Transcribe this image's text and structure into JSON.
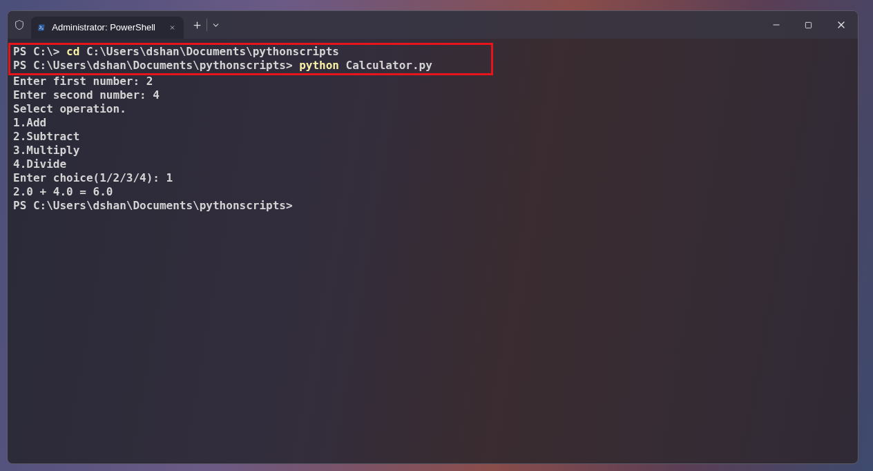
{
  "window": {
    "tab": {
      "title": "Administrator: PowerShell",
      "selected": true
    }
  },
  "terminal": {
    "blocks": [
      {
        "kind": "highlighted",
        "lines": [
          [
            {
              "kind": "prompt",
              "text": "PS C:\\>"
            },
            {
              "kind": "command",
              "text": "cd"
            },
            {
              "kind": "arg",
              "text": "C:\\Users\\dshan\\Documents\\pythonscripts"
            }
          ],
          [
            {
              "kind": "prompt",
              "text": "PS C:\\Users\\dshan\\Documents\\pythonscripts>"
            },
            {
              "kind": "command",
              "text": "python"
            },
            {
              "kind": "arg",
              "text": "Calculator.py"
            }
          ]
        ]
      },
      {
        "kind": "plain",
        "lines": [
          [
            {
              "kind": "output",
              "text": "Enter first number: 2"
            }
          ],
          [
            {
              "kind": "output",
              "text": "Enter second number: 4"
            }
          ],
          [
            {
              "kind": "output",
              "text": "Select operation."
            }
          ],
          [
            {
              "kind": "output",
              "text": "1.Add"
            }
          ],
          [
            {
              "kind": "output",
              "text": "2.Subtract"
            }
          ],
          [
            {
              "kind": "output",
              "text": "3.Multiply"
            }
          ],
          [
            {
              "kind": "output",
              "text": "4.Divide"
            }
          ],
          [
            {
              "kind": "output",
              "text": "Enter choice(1/2/3/4): 1"
            }
          ],
          [
            {
              "kind": "output",
              "text": "2.0 + 4.0 = 6.0"
            }
          ],
          [
            {
              "kind": "prompt",
              "text": "PS C:\\Users\\dshan\\Documents\\pythonscripts>"
            }
          ]
        ]
      }
    ]
  }
}
